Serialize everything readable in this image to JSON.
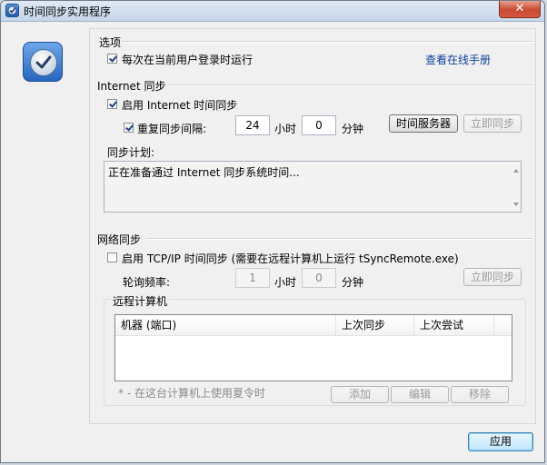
{
  "window": {
    "title": "时间同步实用程序",
    "close_glyph": "✕"
  },
  "options": {
    "title": "选项",
    "run_on_login_label": "每次在当前用户登录时运行",
    "run_on_login_checked": true,
    "online_manual_link": "查看在线手册"
  },
  "internet_sync": {
    "title": "Internet 同步",
    "enable_label": "启用 Internet 时间同步",
    "enable_checked": true,
    "repeat_label": "重复同步间隔:",
    "repeat_checked": true,
    "hours_value": "24",
    "hours_unit": "小时",
    "minutes_value": "0",
    "minutes_unit": "分钟",
    "time_server_button": "时间服务器",
    "sync_now_button": "立即同步",
    "schedule_label": "同步计划:",
    "schedule_text": "正在准备通过 Internet 同步系统时间..."
  },
  "network_sync": {
    "title": "网络同步",
    "enable_label": "启用 TCP/IP 时间同步 (需要在远程计算机上运行 tSyncRemote.exe)",
    "enable_checked": false,
    "poll_label": "轮询频率:",
    "hours_value": "1",
    "hours_unit": "小时",
    "minutes_value": "0",
    "minutes_unit": "分钟",
    "sync_now_button": "立即同步",
    "remote_title": "远程计算机",
    "columns": [
      "机器 (端口)",
      "上次同步",
      "上次尝试"
    ],
    "dst_note": "* - 在这台计算机上使用夏令时",
    "add_button": "添加",
    "edit_button": "编辑",
    "remove_button": "移除"
  },
  "footer": {
    "apply_button": "应用"
  },
  "colors": {
    "link": "#0b3f9e",
    "title_bar": "#c5d5e8",
    "close_button": "#c74a32",
    "accent_icon": "#2766c0"
  }
}
